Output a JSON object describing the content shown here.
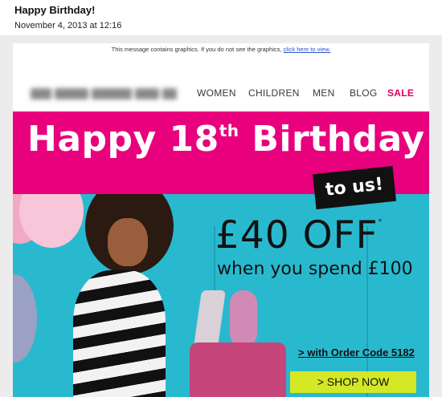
{
  "email": {
    "subject": "Happy Birthday!",
    "date": "November 4, 2013 at 12:16"
  },
  "notice": {
    "text": "This message contains graphics. If you do not see the graphics,",
    "link": "click here to view."
  },
  "nav": {
    "items": [
      "WOMEN",
      "CHILDREN",
      "MEN",
      "BLOG",
      "SALE"
    ]
  },
  "banner": {
    "headline_part1": "Happy 18",
    "headline_sup": "th",
    "headline_part2": " Birthday",
    "to_us": "to us!"
  },
  "offer": {
    "amount": "£40 OFF",
    "asterisk": "*",
    "condition": "when you spend £100",
    "order_code": "> with Order Code 5182",
    "shop_button": "> SHOP NOW"
  },
  "colors": {
    "brand_pink": "#e8007d",
    "hero_teal": "#29b9cf",
    "cta_yellow": "#d4e825",
    "sale_red": "#e1005b"
  },
  "icons": {
    "logo": "blurred-brand-logo"
  }
}
